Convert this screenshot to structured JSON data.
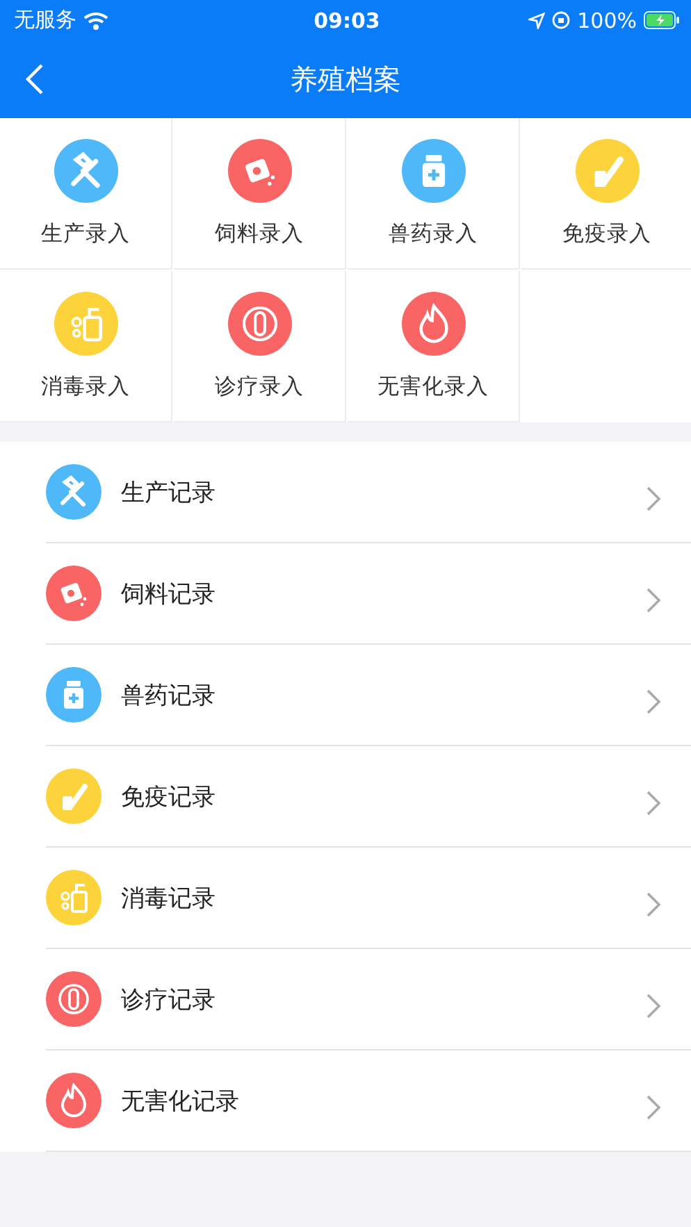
{
  "status_bar": {
    "carrier": "无服务",
    "time": "09:03",
    "battery": "100%"
  },
  "nav": {
    "title": "养殖档案"
  },
  "entries": [
    {
      "label": "生产录入",
      "kind": "tools",
      "color": "#4fb8f8"
    },
    {
      "label": "饲料录入",
      "kind": "feed",
      "color": "#f96464"
    },
    {
      "label": "兽药录入",
      "kind": "medicine",
      "color": "#4fb8f8"
    },
    {
      "label": "免疫录入",
      "kind": "vaccine",
      "color": "#fcd33a"
    },
    {
      "label": "消毒录入",
      "kind": "disinfect",
      "color": "#fcd33a"
    },
    {
      "label": "诊疗录入",
      "kind": "diagnosis",
      "color": "#f96464"
    },
    {
      "label": "无害化录入",
      "kind": "fire",
      "color": "#f96464"
    }
  ],
  "records": [
    {
      "label": "生产记录",
      "kind": "tools",
      "color": "#4fb8f8"
    },
    {
      "label": "饲料记录",
      "kind": "feed",
      "color": "#f96464"
    },
    {
      "label": "兽药记录",
      "kind": "medicine",
      "color": "#4fb8f8"
    },
    {
      "label": "免疫记录",
      "kind": "vaccine",
      "color": "#fcd33a"
    },
    {
      "label": "消毒记录",
      "kind": "disinfect",
      "color": "#fcd33a"
    },
    {
      "label": "诊疗记录",
      "kind": "diagnosis",
      "color": "#f96464"
    },
    {
      "label": "无害化记录",
      "kind": "fire",
      "color": "#f96464"
    }
  ]
}
